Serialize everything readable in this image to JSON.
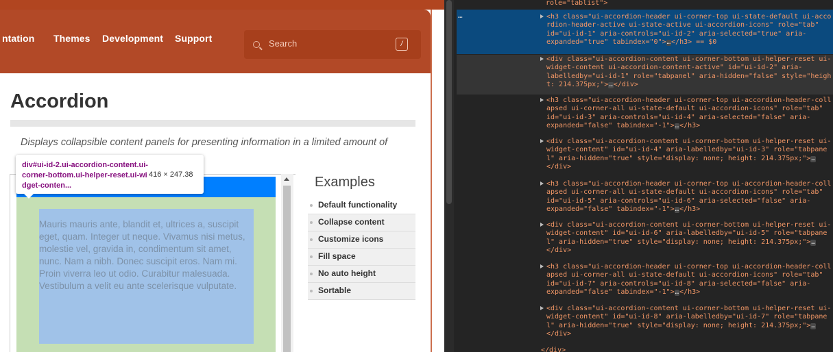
{
  "header": {
    "nav": [
      "ntation",
      "Themes",
      "Development",
      "Support"
    ],
    "search_placeholder": "Search",
    "search_shortcut": "/"
  },
  "page": {
    "title": "Accordion",
    "description": "Displays collapsible content panels for presenting information in a limited amount of"
  },
  "tooltip": {
    "selector": "div#ui-id-2.ui-accordion-content.ui-corner-bottom.ui-helper-reset.ui-widget-conten...",
    "size": "416 × 247.38"
  },
  "demo": {
    "content": "Mauris mauris ante, blandit et, ultrices a, suscipit eget, quam. Integer ut neque. Vivamus nisi metus, molestie vel, gravida in, condimentum sit amet, nunc. Nam a nibh. Donec suscipit eros. Nam mi. Proin viverra leo ut odio. Curabitur malesuada. Vestibulum a velit eu ante scelerisque vulputate."
  },
  "examples": {
    "title": "Examples",
    "items": [
      "Default functionality",
      "Collapse content",
      "Customize icons",
      "Fill space",
      "No auto height",
      "Sortable"
    ]
  },
  "devtools": {
    "top_cut": "role=\"tablist\">",
    "dots": "…",
    "line1a": "<h3 class=\"ui-accordion-header ui-corner-top ui-state-default ui-acco",
    "line1b": "rdion-header-active ui-state-active ui-accordion-icons\" role=\"tab\"",
    "line1c": "id=\"ui-id-1\" aria-controls=\"ui-id-2\" aria-selected=\"true\" aria-",
    "line1d": "expanded=\"true\" tabindex=\"0\">",
    "line1e": "</h3> == $0",
    "line2a": "<div class=\"ui-accordion-content ui-corner-bottom ui-helper-reset ui-",
    "line2b": "widget-content ui-accordion-content-active\" id=\"ui-id-2\" aria-",
    "line2c": "labelledby=\"ui-id-1\" role=\"tabpanel\" aria-hidden=\"false\" style=\"heigh",
    "line2d": "t: 214.375px;\">",
    "line2e": "</div>",
    "line3a": "<h3 class=\"ui-accordion-header ui-corner-top ui-accordion-header-coll",
    "line3b": "apsed ui-corner-all ui-state-default ui-accordion-icons\" role=\"tab\"",
    "line3c": "id=\"ui-id-3\" aria-controls=\"ui-id-4\" aria-selected=\"false\" aria-",
    "line3d": "expanded=\"false\" tabindex=\"-1\">",
    "line3e": "</h3>",
    "line4a": "<div class=\"ui-accordion-content ui-corner-bottom ui-helper-reset ui-",
    "line4b": "widget-content\" id=\"ui-id-4\" aria-labelledby=\"ui-id-3\" role=\"tabpane",
    "line4c": "l\" aria-hidden=\"true\" style=\"display: none; height: 214.375px;\">",
    "line4d": "</div>",
    "line5a": "<h3 class=\"ui-accordion-header ui-corner-top ui-accordion-header-coll",
    "line5b": "apsed ui-corner-all ui-state-default ui-accordion-icons\" role=\"tab\"",
    "line5c": "id=\"ui-id-5\" aria-controls=\"ui-id-6\" aria-selected=\"false\" aria-",
    "line5d": "expanded=\"false\" tabindex=\"-1\">",
    "line5e": "</h3>",
    "line6a": "<div class=\"ui-accordion-content ui-corner-bottom ui-helper-reset ui-",
    "line6b": "widget-content\" id=\"ui-id-6\" aria-labelledby=\"ui-id-5\" role=\"tabpane",
    "line6c": "l\" aria-hidden=\"true\" style=\"display: none; height: 214.375px;\">",
    "line6d": "</div>",
    "line7a": "<h3 class=\"ui-accordion-header ui-corner-top ui-accordion-header-coll",
    "line7b": "apsed ui-corner-all ui-state-default ui-accordion-icons\" role=\"tab\"",
    "line7c": "id=\"ui-id-7\" aria-controls=\"ui-id-8\" aria-selected=\"false\" aria-",
    "line7d": "expanded=\"false\" tabindex=\"-1\">",
    "line7e": "</h3>",
    "line8a": "<div class=\"ui-accordion-content ui-corner-bottom ui-helper-reset ui-",
    "line8b": "widget-content\" id=\"ui-id-8\" aria-labelledby=\"ui-id-7\" role=\"tabpane",
    "line8c": "l\" aria-hidden=\"true\" style=\"display: none; height: 214.375px;\">",
    "line8d": "</div>",
    "close_div": "</div>",
    "ellipsis": "…"
  },
  "colors": {
    "header": "#b24927",
    "accordion_header_active": "#007fff",
    "padding_overlay": "#c5dfb4",
    "content_overlay": "#a0c2e8",
    "devtools_bg": "#242424",
    "selected_row": "#0b4a7e",
    "tag_color": "#f29766"
  }
}
